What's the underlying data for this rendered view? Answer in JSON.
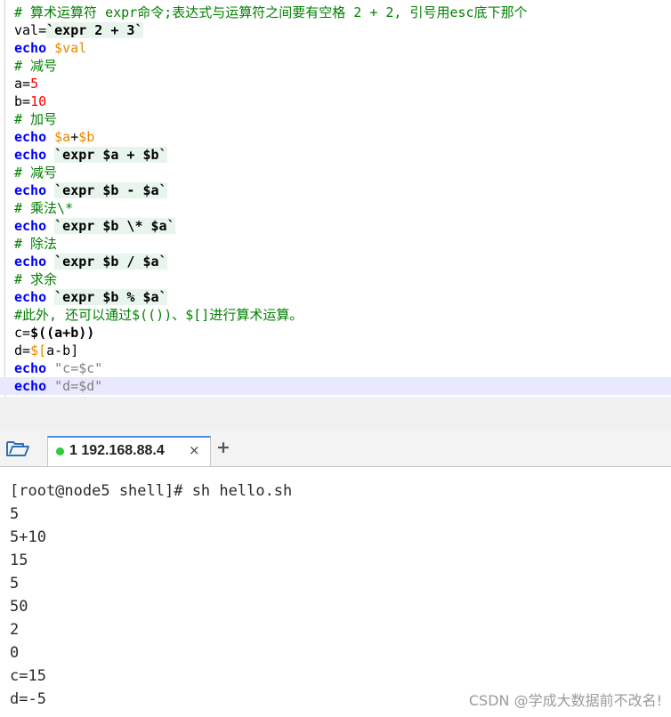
{
  "editor": {
    "lines": [
      [
        {
          "t": "# 算术运算符 expr命令;表达式与运算符之间要有空格 2 + 2, 引号用esc底下那个",
          "c": "cmt"
        }
      ],
      [
        {
          "t": "val=",
          "c": ""
        },
        {
          "t": "`expr 2 + 3`",
          "c": "bt bold"
        }
      ],
      [
        {
          "t": "echo",
          "c": "kw"
        },
        {
          "t": " ",
          "c": ""
        },
        {
          "t": "$val",
          "c": "var"
        }
      ],
      [
        {
          "t": "# 减号",
          "c": "cmt"
        }
      ],
      [
        {
          "t": "a=",
          "c": ""
        },
        {
          "t": "5",
          "c": "num"
        }
      ],
      [
        {
          "t": "b=",
          "c": ""
        },
        {
          "t": "10",
          "c": "num"
        }
      ],
      [
        {
          "t": "# 加号",
          "c": "cmt"
        }
      ],
      [
        {
          "t": "echo",
          "c": "kw"
        },
        {
          "t": " ",
          "c": ""
        },
        {
          "t": "$a",
          "c": "var"
        },
        {
          "t": "+",
          "c": ""
        },
        {
          "t": "$b",
          "c": "var"
        }
      ],
      [
        {
          "t": "echo",
          "c": "kw"
        },
        {
          "t": " ",
          "c": ""
        },
        {
          "t": "`expr $a + $b`",
          "c": "bt bold"
        }
      ],
      [
        {
          "t": "# 减号",
          "c": "cmt"
        }
      ],
      [
        {
          "t": "echo",
          "c": "kw"
        },
        {
          "t": " ",
          "c": ""
        },
        {
          "t": "`expr $b - $a`",
          "c": "bt bold"
        }
      ],
      [
        {
          "t": "# 乘法\\*",
          "c": "cmt"
        }
      ],
      [
        {
          "t": "echo",
          "c": "kw"
        },
        {
          "t": " ",
          "c": ""
        },
        {
          "t": "`expr $b \\* $a`",
          "c": "bt bold"
        }
      ],
      [
        {
          "t": "# 除法",
          "c": "cmt"
        }
      ],
      [
        {
          "t": "echo",
          "c": "kw"
        },
        {
          "t": " ",
          "c": ""
        },
        {
          "t": "`expr $b / $a`",
          "c": "bt bold"
        }
      ],
      [
        {
          "t": "# 求余",
          "c": "cmt"
        }
      ],
      [
        {
          "t": "echo",
          "c": "kw"
        },
        {
          "t": " ",
          "c": ""
        },
        {
          "t": "`expr $b % $a`",
          "c": "bt bold"
        }
      ],
      [
        {
          "t": "#此外, 还可以通过$(())、$[]进行算术运算。",
          "c": "cmt"
        }
      ],
      [
        {
          "t": "c=",
          "c": ""
        },
        {
          "t": "$((a+b))",
          "c": "bold"
        }
      ],
      [
        {
          "t": "d=",
          "c": ""
        },
        {
          "t": "$[",
          "c": "var"
        },
        {
          "t": "a",
          "c": ""
        },
        {
          "t": "-b]",
          "c": ""
        }
      ],
      [
        {
          "t": "echo",
          "c": "kw"
        },
        {
          "t": " ",
          "c": ""
        },
        {
          "t": "\"c=$c\"",
          "c": "str"
        }
      ],
      [
        {
          "t": "echo",
          "c": "kw"
        },
        {
          "t": " ",
          "c": ""
        },
        {
          "t": "\"d=$d\"",
          "c": "str"
        }
      ]
    ]
  },
  "tabs": {
    "folder_icon": "folder-open-icon",
    "active_tab": {
      "label": "1 192.168.88.4",
      "close": "×",
      "status_color": "#2ecc40"
    },
    "add_label": "+"
  },
  "terminal": {
    "lines": [
      "[root@node5 shell]# sh hello.sh",
      "5",
      "5+10",
      "15",
      "5",
      "50",
      "2",
      "0",
      "c=15",
      "d=-5"
    ]
  },
  "watermark": "CSDN @学成大数据前不改名!"
}
